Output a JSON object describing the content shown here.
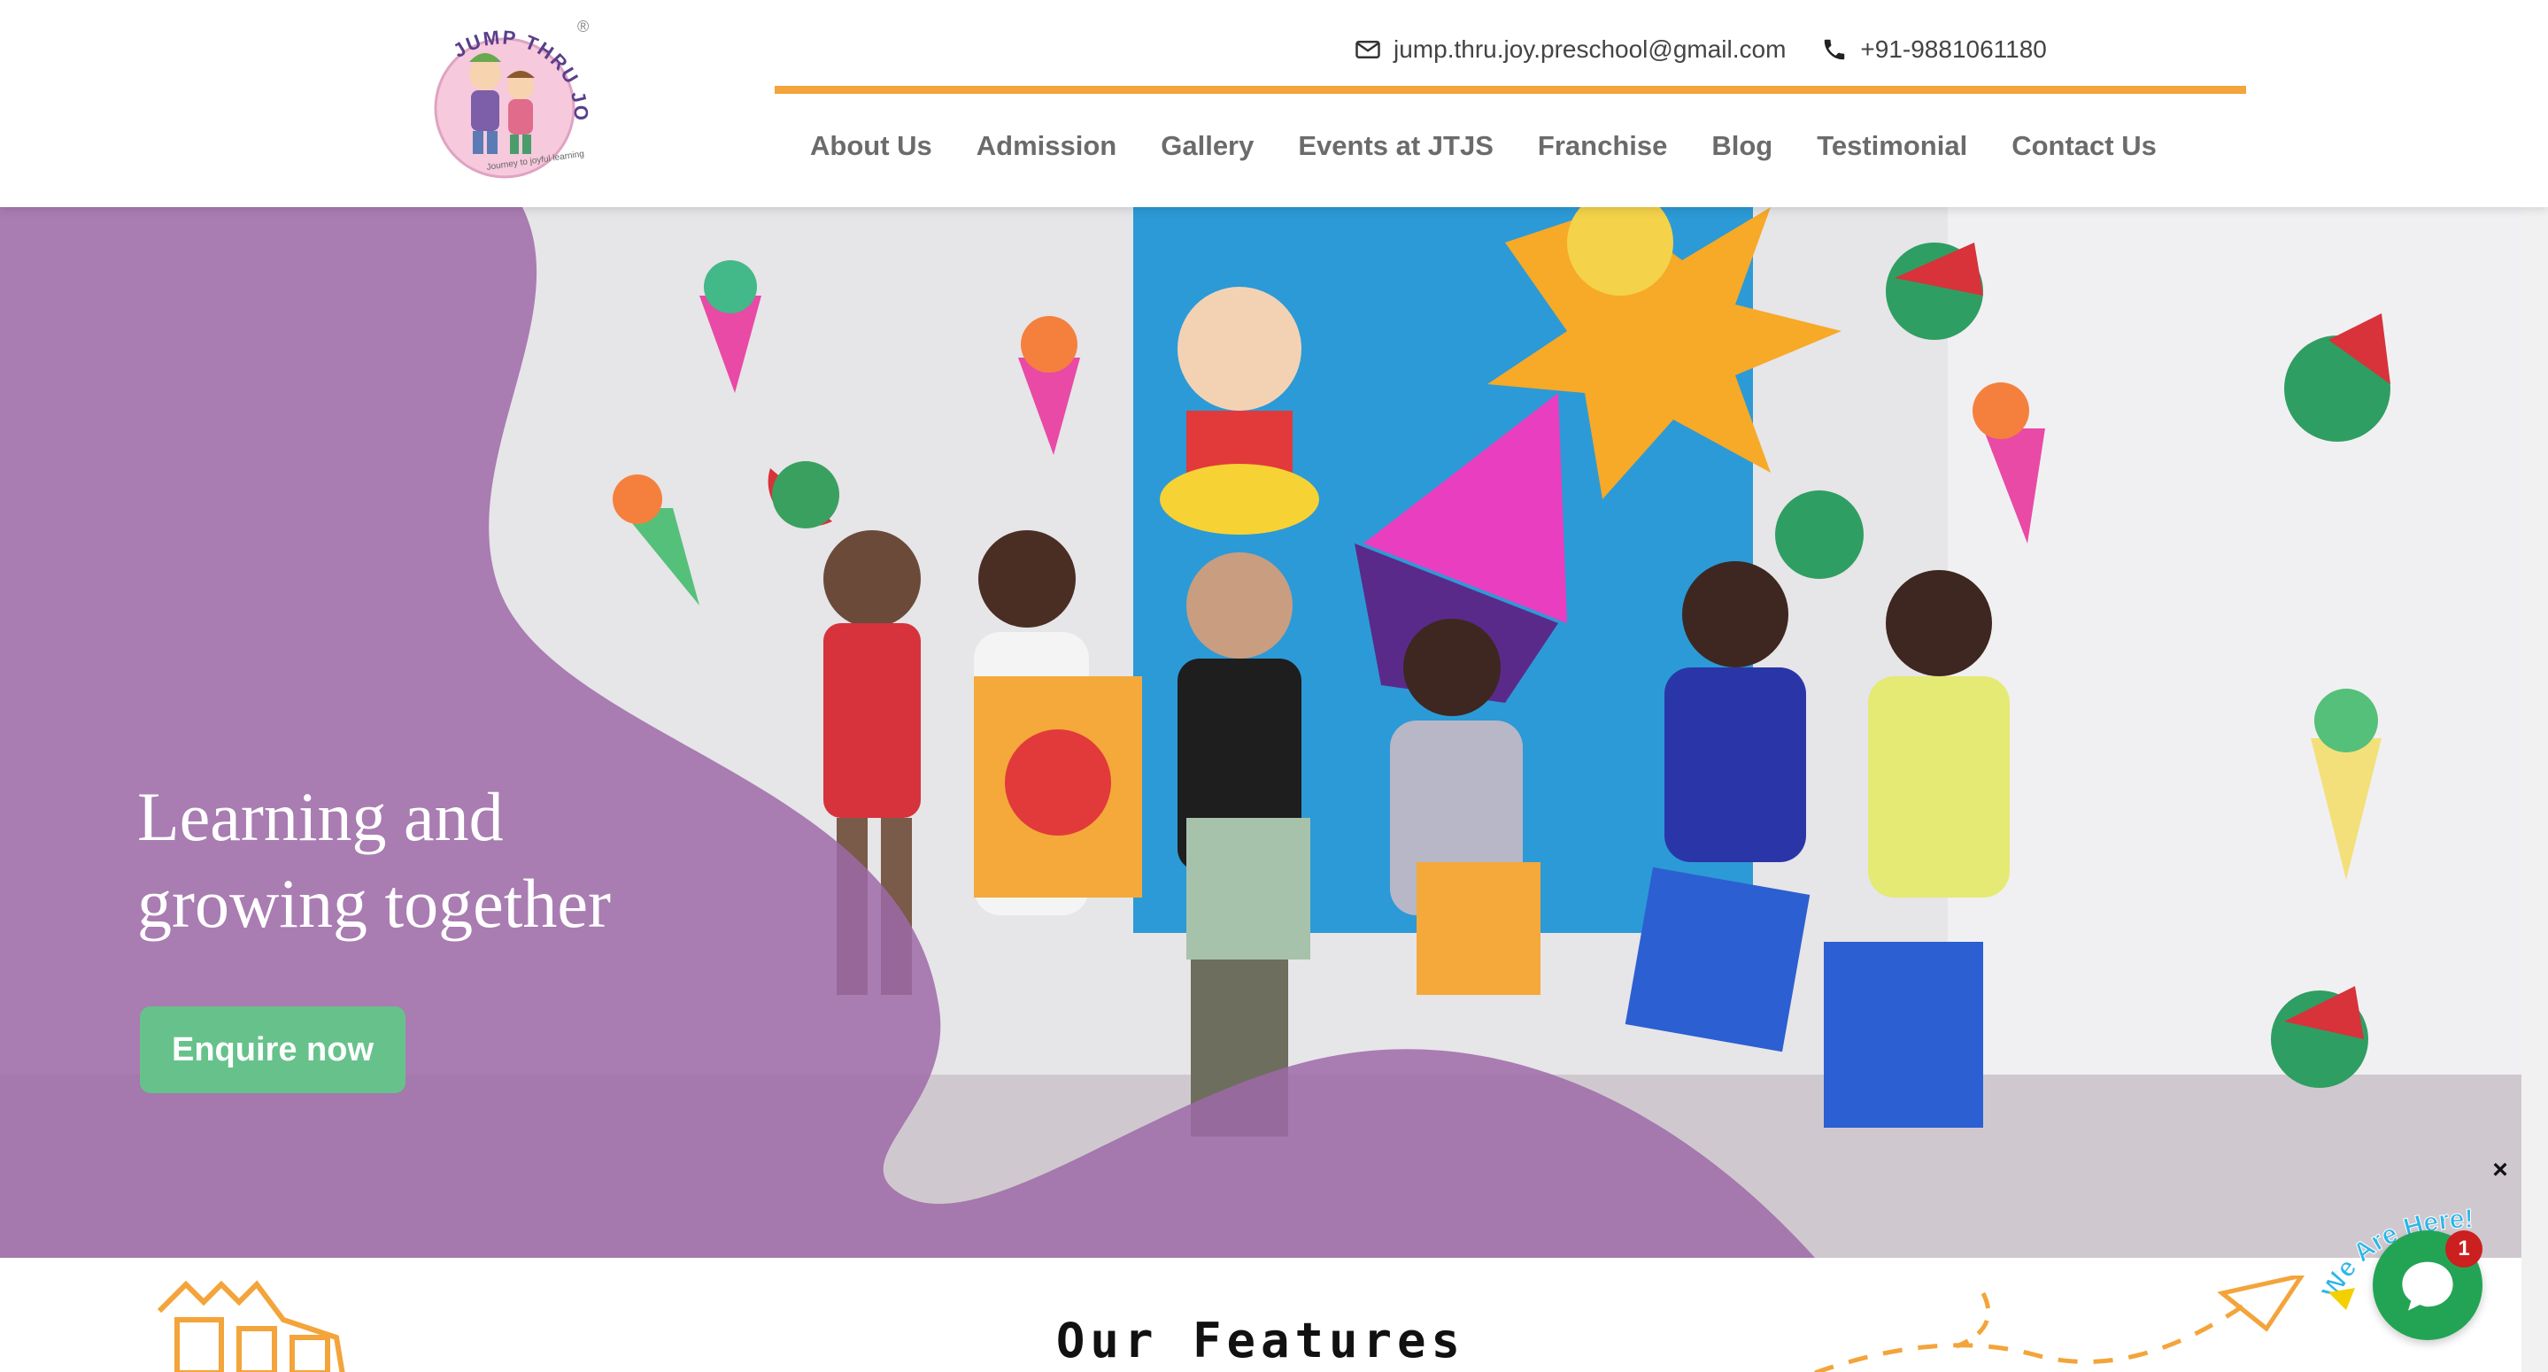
{
  "brand": {
    "logo_text": "JUMP THRU JOY",
    "logo_tagline": "Journey to joyful learning",
    "registered_mark": "®",
    "colors": {
      "accent_orange": "#f3a43a",
      "hero_purple": "#9d6aa8",
      "button_green": "#66c28a",
      "chat_green": "#23a455",
      "badge_red": "#cc1f1f"
    }
  },
  "contact": {
    "email_icon": "envelope-icon",
    "email": "jump.thru.joy.preschool@gmail.com",
    "phone_icon": "phone-icon",
    "phone": "+91-9881061180"
  },
  "nav": {
    "items": [
      {
        "label": "About Us"
      },
      {
        "label": "Admission"
      },
      {
        "label": "Gallery"
      },
      {
        "label": "Events at JTJS"
      },
      {
        "label": "Franchise"
      },
      {
        "label": "Blog"
      },
      {
        "label": "Testimonial"
      },
      {
        "label": "Contact Us"
      }
    ]
  },
  "hero": {
    "title_line1": "Learning and",
    "title_line2": "growing together",
    "cta_label": "Enquire now",
    "image_description_icon": "children-classroom-photo"
  },
  "features": {
    "title": "Our Features",
    "left_icon": "castle-icon",
    "right_icon": "paper-plane-icon"
  },
  "chat_widget": {
    "banner_text": "We Are Here!",
    "badge_count": "1",
    "close_symbol": "×",
    "icon": "chat-bubble-icon"
  }
}
